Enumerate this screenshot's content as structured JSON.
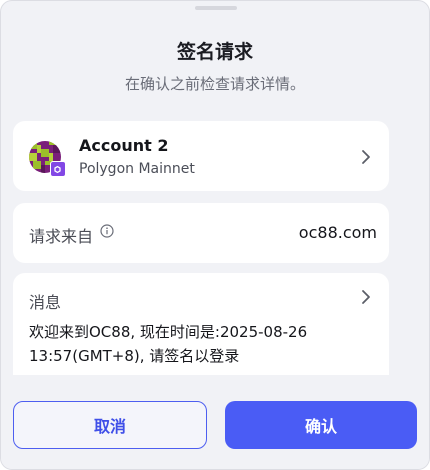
{
  "header": {
    "title": "签名请求",
    "subtitle": "在确认之前检查请求详情。"
  },
  "account": {
    "name": "Account 2",
    "network": "Polygon Mainnet",
    "avatar_icon": "pixel-avatar-icon",
    "chain_icon": "polygon-icon"
  },
  "origin": {
    "label": "请求来自",
    "value": "oc88.com",
    "info_icon": "info-icon"
  },
  "message": {
    "label": "消息",
    "text": "欢迎来到OC88, 现在时间是:2025-08-26 13:57(GMT+8), 请签名以登录"
  },
  "buttons": {
    "cancel": "取消",
    "confirm": "确认"
  },
  "colors": {
    "accent": "#4a5cf5",
    "polygon": "#8247e5",
    "background": "#f1f2f6"
  }
}
